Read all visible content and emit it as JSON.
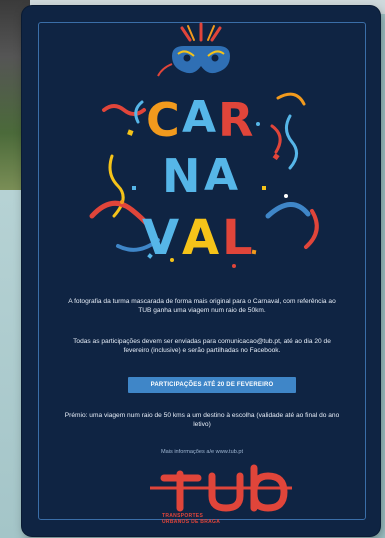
{
  "poster": {
    "headline": "CARNAVAL",
    "headline_lines": [
      "CAR",
      "NA",
      "VAL"
    ],
    "paragraph_1": "A fotografia da turma mascarada de forma mais original para o Carnaval, com referência ao TUB ganha uma viagem num raio de 50km.",
    "paragraph_2": "Todas as participações devem ser enviadas para comunicacao@tub.pt, até ao dia 20 de fevereiro (inclusive) e serão partilhadas no Facebook.",
    "cta_label": "PARTICIPAÇÕES ATÉ 20 DE FEVEREIRO",
    "paragraph_3": "Prémio: uma viagem num raio de 50 kms a um destino à escolha (validade até ao final do ano letivo)",
    "more_info": "Mais informações a/e www.tub.pt",
    "logo_text": "TUB",
    "logo_subtitle_1": "TRANSPORTES",
    "logo_subtitle_2": "URBANOS DE BRAGA"
  },
  "colors": {
    "poster_bg": "#0f2443",
    "red": "#e0453a",
    "orange": "#f29a1d",
    "yellow": "#f5c319",
    "blue": "#3f86c8",
    "light_blue": "#56b6e8"
  },
  "icons": [
    "carnival-mask-icon",
    "confetti-decoration",
    "streamer-decoration",
    "tub-logo"
  ]
}
